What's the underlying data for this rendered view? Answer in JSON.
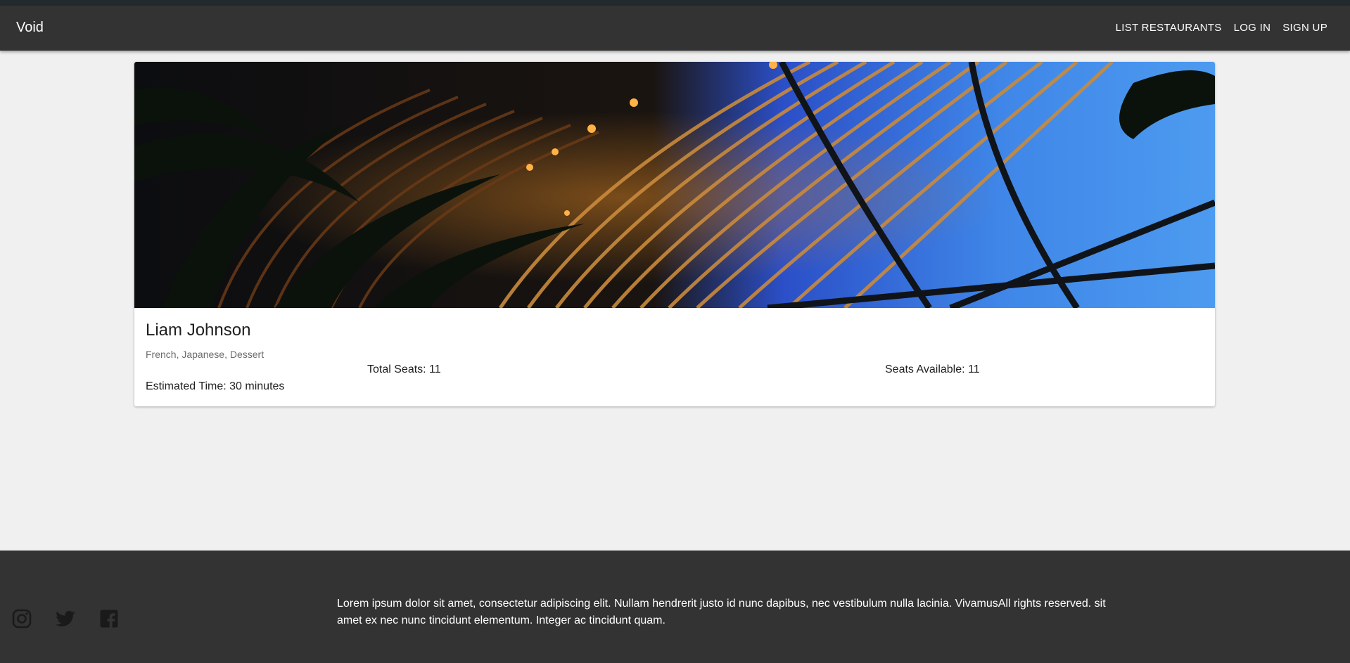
{
  "header": {
    "brand": "Void",
    "nav": [
      {
        "label": "LIST RESTAURANTS"
      },
      {
        "label": "LOG IN"
      },
      {
        "label": "SIGN UP"
      }
    ]
  },
  "restaurant": {
    "name": "Liam Johnson",
    "cuisines": "French, Japanese, Dessert",
    "total_seats": "Total Seats: 11",
    "seats_available": "Seats Available: 11",
    "estimated_time": "Estimated Time: 30 minutes"
  },
  "footer": {
    "text": "Lorem ipsum dolor sit amet, consectetur adipiscing elit. Nullam hendrerit justo id nunc dapibus, nec vestibulum nulla lacinia. VivamusAll rights reserved. sit amet ex nec nunc tincidunt elementum. Integer ac tincidunt quam.",
    "social_icons": [
      "instagram-icon",
      "twitter-icon",
      "facebook-icon"
    ]
  },
  "colors": {
    "appbar": "#333333",
    "page_background": "#f0f0f0",
    "footer": "#333333",
    "icon": "#1a1a1a"
  }
}
